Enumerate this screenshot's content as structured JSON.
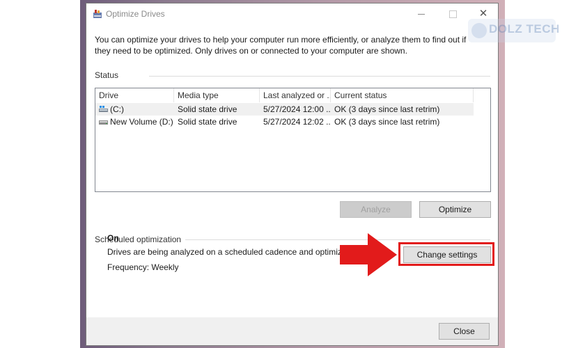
{
  "window": {
    "title": "Optimize Drives",
    "description": "You can optimize your drives to help your computer run more efficiently, or analyze them to find out if they need to be optimized. Only drives on or connected to your computer are shown."
  },
  "status": {
    "label": "Status",
    "columns": [
      "Drive",
      "Media type",
      "Last analyzed or ...",
      "Current status"
    ],
    "drives": [
      {
        "drive": "(C:)",
        "icon": "system-drive-icon",
        "media_type": "Solid state drive",
        "last_analyzed": "5/27/2024 12:00 ...",
        "current_status": "OK (3 days since last retrim)"
      },
      {
        "drive": "New Volume (D:)",
        "icon": "drive-icon",
        "media_type": "Solid state drive",
        "last_analyzed": "5/27/2024 12:02 ...",
        "current_status": "OK (3 days since last retrim)"
      }
    ],
    "analyze_label": "Analyze",
    "optimize_label": "Optimize"
  },
  "scheduled": {
    "label": "Scheduled optimization",
    "state": "On",
    "description": "Drives are being analyzed on a scheduled cadence and optimized as...",
    "frequency": "Frequency: Weekly",
    "change_settings_label": "Change settings"
  },
  "footer": {
    "close_label": "Close"
  },
  "watermark": {
    "text": "DOLZ TECH"
  },
  "colors": {
    "highlight": "#e21b1b",
    "arrow": "#e21b1b",
    "list_border": "#828790"
  }
}
